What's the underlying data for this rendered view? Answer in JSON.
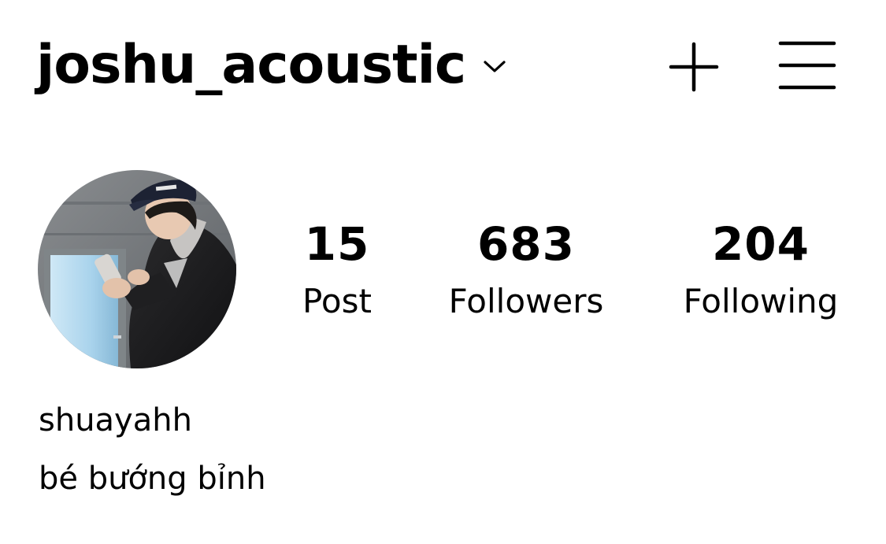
{
  "header": {
    "username": "joshu_acoustic",
    "account_switcher_icon": "chevron-down-icon",
    "create_icon": "plus-icon",
    "menu_icon": "hamburger-menu-icon"
  },
  "profile": {
    "avatar": "profile-photo",
    "stats": [
      {
        "count": "15",
        "label": "Post"
      },
      {
        "count": "683",
        "label": "Followers"
      },
      {
        "count": "204",
        "label": "Following"
      }
    ],
    "display_name": "shuayahh",
    "bio": "bé bướng bỉnh"
  }
}
